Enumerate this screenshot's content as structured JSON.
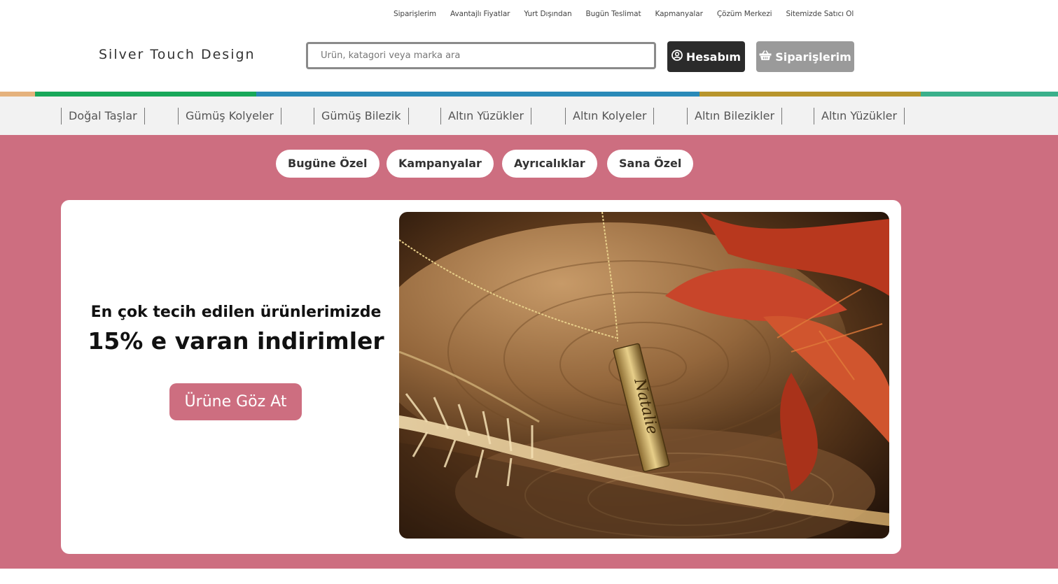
{
  "top_links": [
    "Siparişlerim",
    "Avantajlı Fiyatlar",
    "Yurt Dışından",
    "Bugün Teslimat",
    "Kapmanyalar",
    "Çözüm Merkezi",
    "Sitemizde Satıcı Ol"
  ],
  "header": {
    "logo": "Silver Touch Design",
    "search_placeholder": "Ürün, katagori veya marka ara",
    "account_label": "Hesabım",
    "orders_label": "Siparişlerim"
  },
  "stripe_colors": [
    "#e5b27d",
    "#18a85a",
    "#2a8ab8",
    "#b8952c",
    "#3ab08b"
  ],
  "categories": [
    "Doğal Taşlar",
    "Gümüş Kolyeler",
    "Gümüş Bilezik",
    "Altın Yüzükler",
    "Altın Kolyeler",
    "Altın Bilezikler",
    "Altın Yüzükler"
  ],
  "pills": [
    "Bugüne Özel",
    "Kampanyalar",
    "Ayrıcalıklar",
    "Sana Özel"
  ],
  "banner": {
    "headline_small": "En çok tecih edilen ürünlerimizde",
    "headline_big": "15% e varan indirimler",
    "cta_label": "Ürüne Göz At",
    "pendant_engraving": "Natalie"
  },
  "colors": {
    "accent": "#cd6e80",
    "dark_button": "#2b2b2b",
    "gray_button": "#9a9a9a"
  }
}
